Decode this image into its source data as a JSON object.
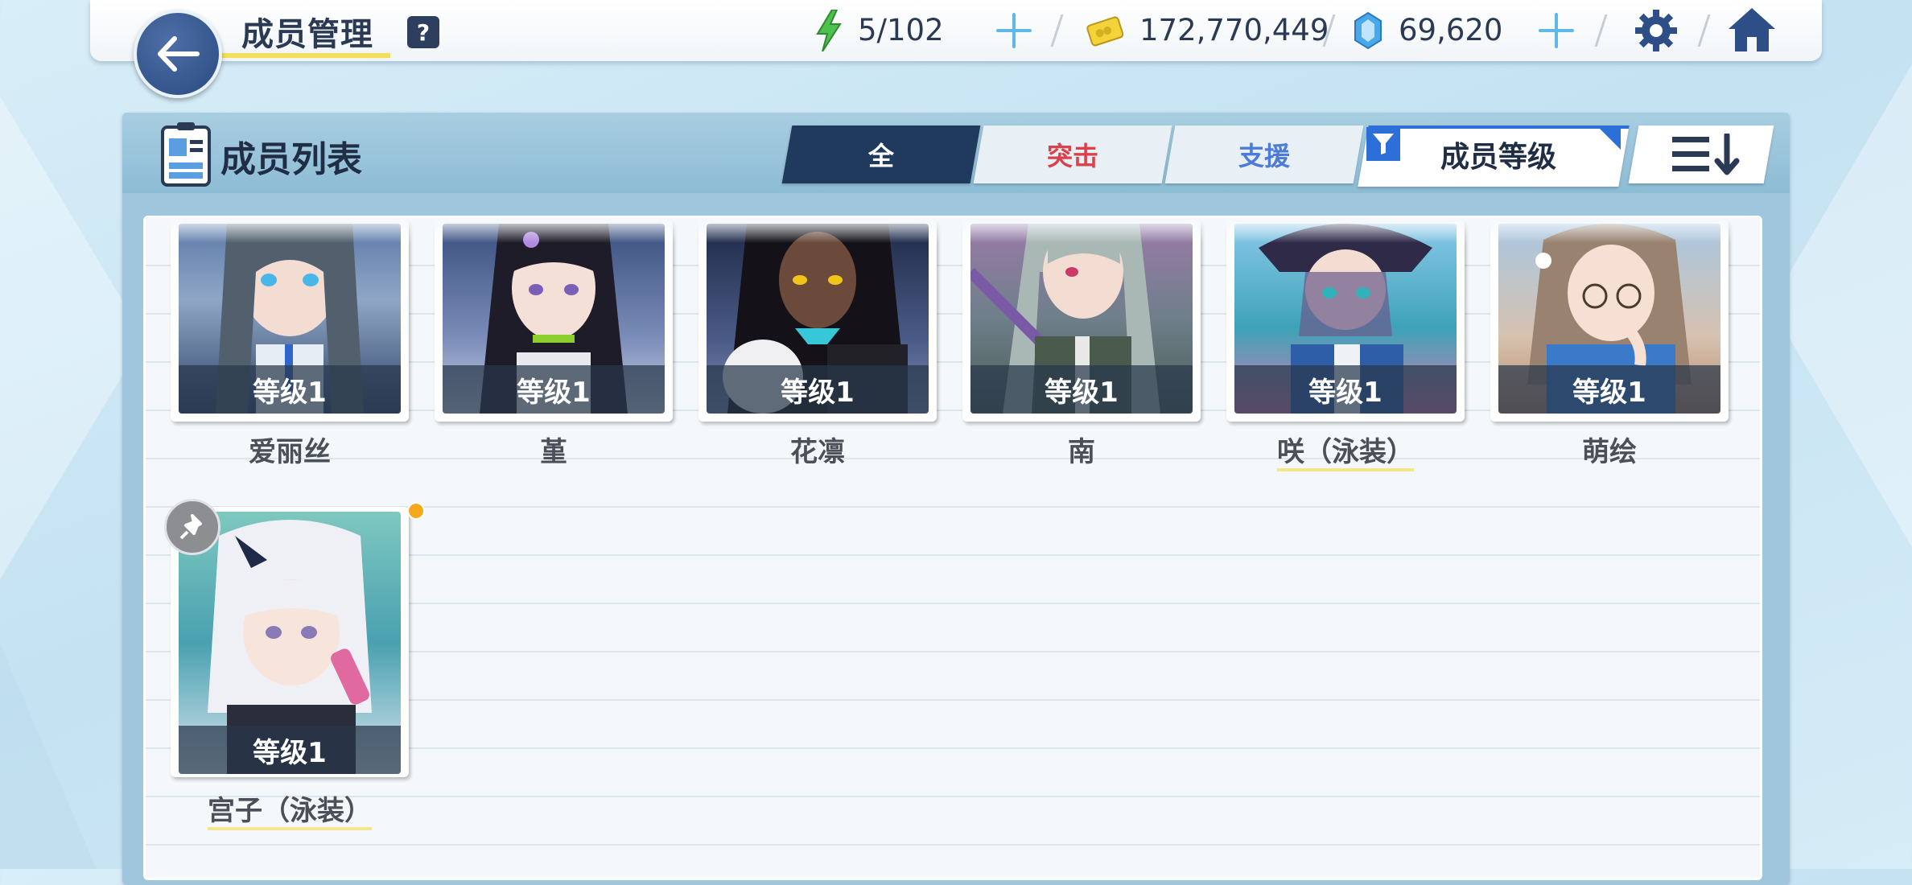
{
  "header": {
    "title": "成员管理",
    "help_label": "?",
    "ap": "5/102",
    "credits": "172,770,449",
    "gems": "69,620"
  },
  "panel": {
    "title": "成员列表",
    "tabs": [
      {
        "label": "全"
      },
      {
        "label": "突击"
      },
      {
        "label": "支援"
      }
    ],
    "filter_label": "成员等级"
  },
  "members": [
    {
      "name": "爱丽丝",
      "level": "等级1"
    },
    {
      "name": "堇",
      "level": "等级1"
    },
    {
      "name": "花凛",
      "level": "等级1"
    },
    {
      "name": "南",
      "level": "等级1"
    },
    {
      "name": "咲（泳装）",
      "level": "等级1"
    },
    {
      "name": "萌绘",
      "level": "等级1"
    },
    {
      "name": "宫子（泳装）",
      "level": "等级1"
    }
  ],
  "icons": {
    "back": "arrow-left-icon",
    "ap": "lightning-icon",
    "credits": "credit-card-icon",
    "gems": "crystal-icon",
    "settings": "gear-icon",
    "home": "home-icon",
    "list": "member-card-icon",
    "filter": "filter-icon",
    "sort": "sort-descending-icon",
    "pin": "pin-icon"
  },
  "colors": {
    "accent_navy": "#1f3a5c",
    "striker_red": "#d9424a",
    "special_blue": "#4d7bd8",
    "highlight_yellow": "#f2df5c"
  }
}
